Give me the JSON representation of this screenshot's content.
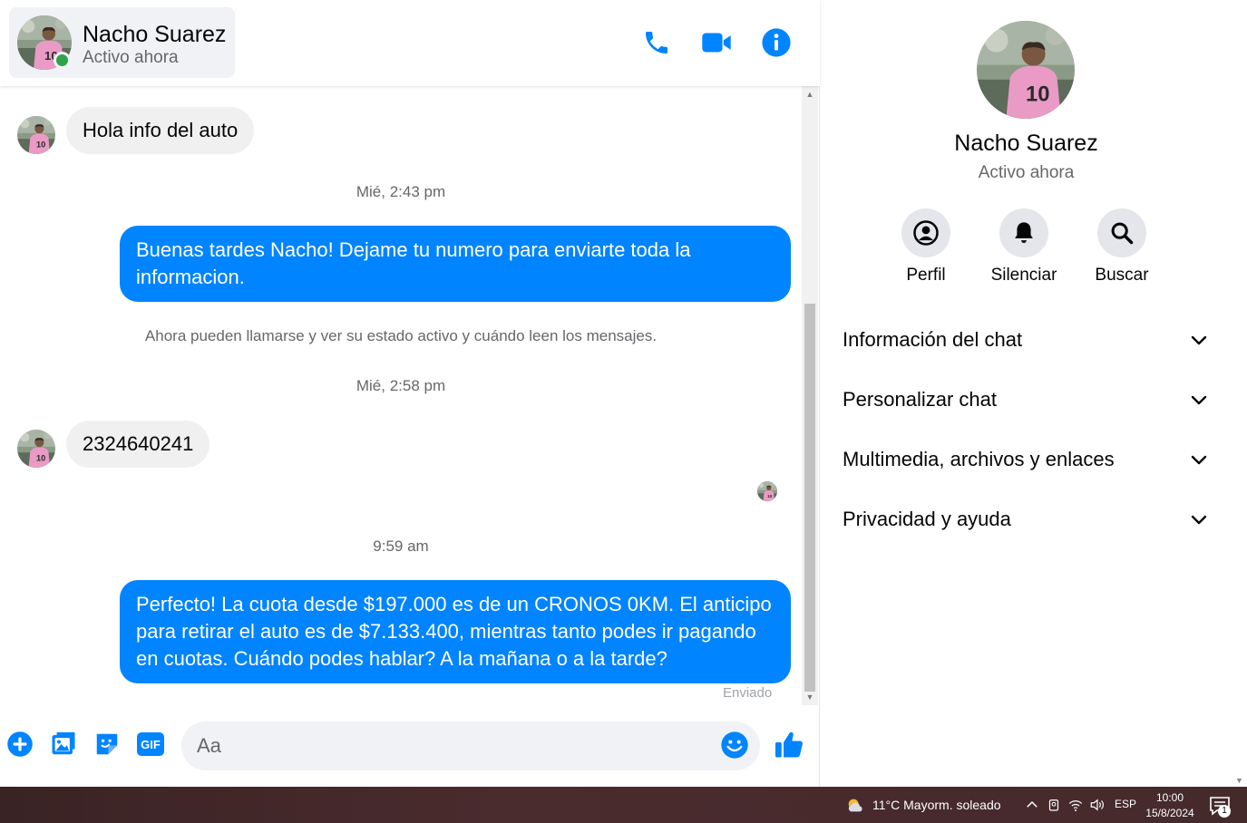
{
  "colors": {
    "accent": "#0084ff",
    "online": "#31a24c",
    "bubble_in": "#f0f0f0"
  },
  "contact": {
    "name": "Nacho Suarez",
    "status": "Activo ahora"
  },
  "header_icons": [
    "phone-icon",
    "video-icon",
    "info-icon"
  ],
  "messages": {
    "m1_text": "Hola info del auto",
    "ts1": "Mié, 2:43 pm",
    "m2_text": "Buenas tardes Nacho! Dejame tu numero para enviarte toda la informacion.",
    "system_note": "Ahora pueden llamarse y ver su estado activo y cuándo leen los mensajes.",
    "ts2": "Mié, 2:58 pm",
    "m3_text": "2324640241",
    "ts3": "9:59 am",
    "m4_text": "Perfecto! La cuota desde $197.000 es de un CRONOS 0KM. El anticipo para retirar el auto es de $7.133.400, mientras tanto podes ir pagando en cuotas. Cuándo podes hablar? A la mañana o a la tarde?",
    "sent_label": "Enviado"
  },
  "composer": {
    "placeholder": "Aa",
    "icons": [
      "plus-icon",
      "image-icon",
      "sticker-icon",
      "gif-icon",
      "emoji-icon",
      "thumbs-up-icon"
    ],
    "gif_label": "GIF"
  },
  "info_panel": {
    "name": "Nacho Suarez",
    "status": "Activo ahora",
    "actions": [
      {
        "label": "Perfil",
        "icon": "profile-icon"
      },
      {
        "label": "Silenciar",
        "icon": "bell-icon"
      },
      {
        "label": "Buscar",
        "icon": "search-icon"
      }
    ],
    "sections": [
      {
        "label": "Información del chat"
      },
      {
        "label": "Personalizar chat"
      },
      {
        "label": "Multimedia, archivos y enlaces"
      },
      {
        "label": "Privacidad y ayuda"
      }
    ]
  },
  "taskbar": {
    "weather": "11°C  Mayorm. soleado",
    "language": "ESP",
    "time": "10:00",
    "date": "15/8/2024",
    "notification_count": "1"
  }
}
